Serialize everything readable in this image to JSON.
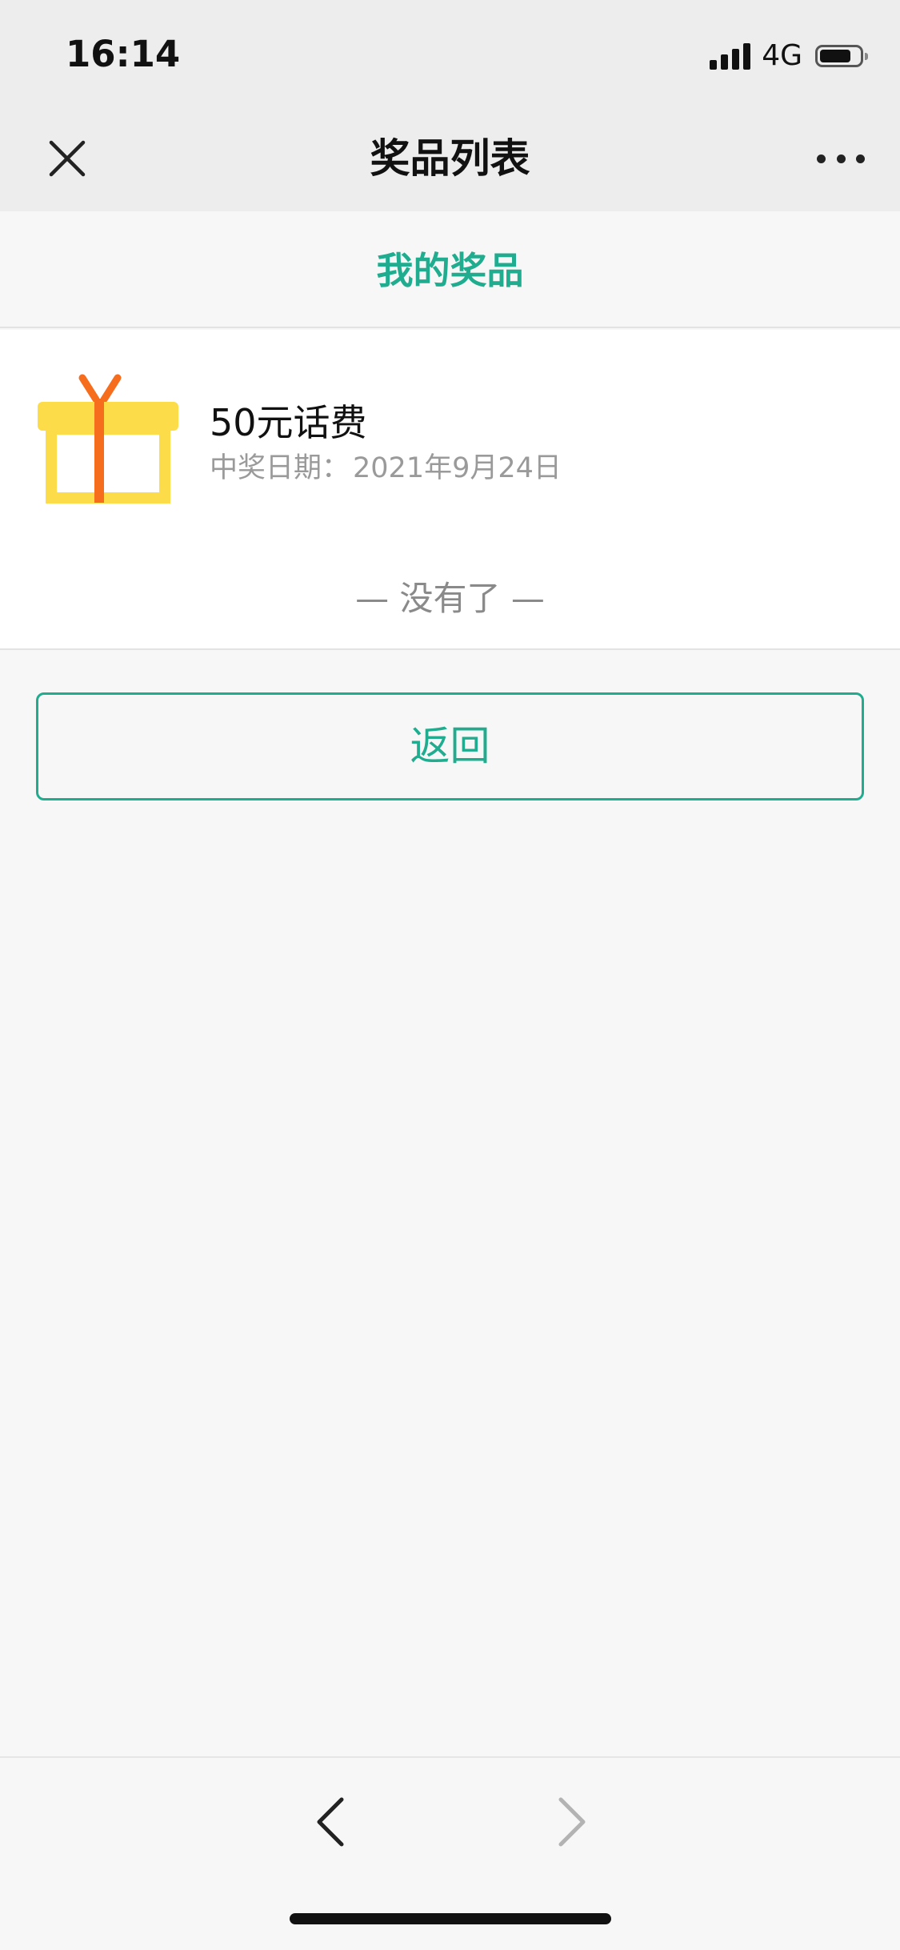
{
  "status_bar": {
    "time": "16:14",
    "network": "4G",
    "icons": [
      "signal-icon",
      "battery-icon"
    ]
  },
  "nav_bar": {
    "title": "奖品列表",
    "icons": [
      "close-icon",
      "more-icon"
    ]
  },
  "section": {
    "title": "我的奖品"
  },
  "prizes": [
    {
      "icon": "gift-icon",
      "name": "50元话费",
      "date_label": "中奖日期：",
      "date": "2021年9月24日"
    }
  ],
  "list_end_text": "— 没有了 —",
  "back_button_label": "返回",
  "bottom_bar": {
    "icons": [
      "chevron-left-icon",
      "chevron-right-icon"
    ]
  },
  "colors": {
    "accent": "#20ac8e",
    "background": "#f7f7f7",
    "header": "#ededed",
    "gift_box": "#fcdc48",
    "gift_ribbon": "#f76d1e"
  }
}
